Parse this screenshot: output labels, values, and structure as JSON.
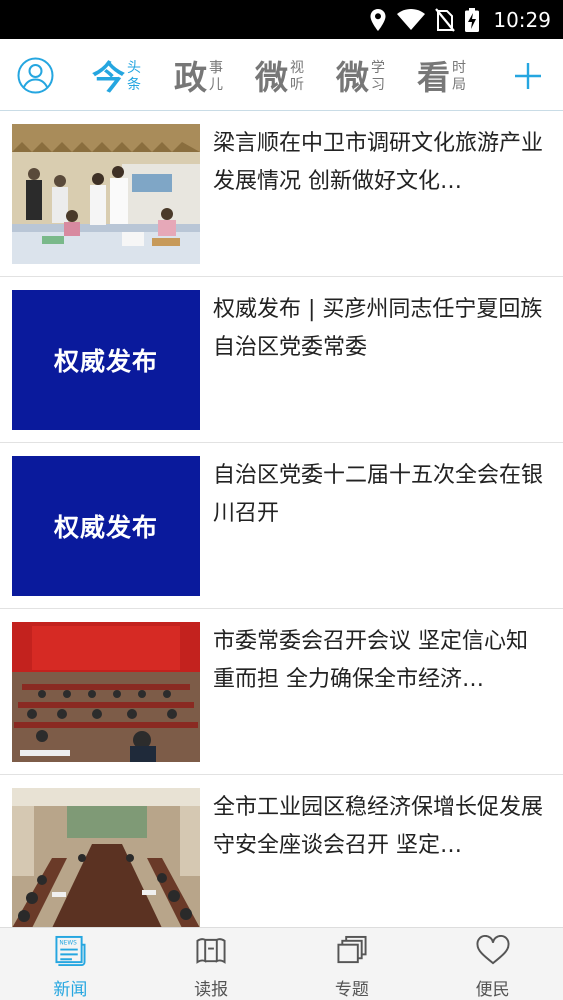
{
  "status_bar": {
    "time": "10:29",
    "icons": [
      "location-icon",
      "wifi-icon",
      "no-sim-icon",
      "battery-charging-icon"
    ]
  },
  "header": {
    "avatar_icon": "user-avatar-icon",
    "tabs": [
      {
        "big": "今",
        "small_top": "头",
        "small_bottom": "条",
        "active": true
      },
      {
        "big": "政",
        "small_top": "事",
        "small_bottom": "儿",
        "active": false
      },
      {
        "big": "微",
        "small_top": "视",
        "small_bottom": "听",
        "active": false
      },
      {
        "big": "微",
        "small_top": "学",
        "small_bottom": "习",
        "active": false
      },
      {
        "big": "看",
        "small_top": "时",
        "small_bottom": "局",
        "active": false
      }
    ],
    "add_icon": "plus-icon",
    "accent_color": "#25a6e0"
  },
  "news": [
    {
      "title": "梁言顺在中卫市调研文化旅游产业发展情况 创新做好文化…",
      "thumb": "photo-meeting-outdoor"
    },
    {
      "title": "权威发布 | 买彦州同志任宁夏回族自治区党委常委",
      "thumb": "authority-card",
      "card_text": "权威发布"
    },
    {
      "title": "自治区党委十二届十五次全会在银川召开",
      "thumb": "authority-card",
      "card_text": "权威发布"
    },
    {
      "title": "市委常委会召开会议 坚定信心知重而担 全力确保全市经济…",
      "thumb": "photo-conference-hall"
    },
    {
      "title": "全市工业园区稳经济保增长促发展守安全座谈会召开  坚定…",
      "thumb": "photo-meeting-room"
    }
  ],
  "bottom_nav": [
    {
      "label": "新闻",
      "icon": "newspaper-icon",
      "active": true
    },
    {
      "label": "读报",
      "icon": "reader-icon",
      "active": false
    },
    {
      "label": "专题",
      "icon": "topics-icon",
      "active": false
    },
    {
      "label": "便民",
      "icon": "heart-icon",
      "active": false
    }
  ]
}
